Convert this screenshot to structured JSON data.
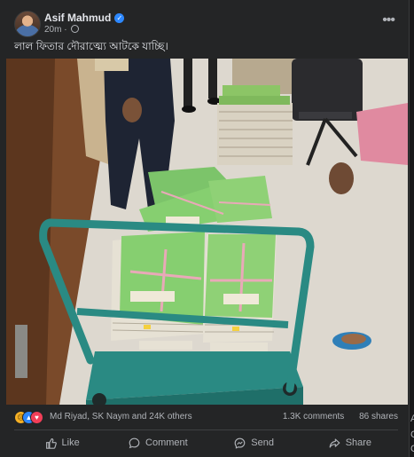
{
  "post": {
    "author": "Asif Mahmud",
    "time": "20m",
    "text": "লাল ফিতার দৌরাত্ম্যে আটকে যাচ্ছি।"
  },
  "reactions": {
    "names": "Md Riyad, SK Naym and 24K others",
    "comments": "1.3K comments",
    "shares": "86 shares"
  },
  "actions": {
    "like": "Like",
    "comment": "Comment",
    "send": "Send",
    "share": "Share"
  },
  "side_fragments": [
    "A",
    "C",
    "C"
  ],
  "colors": {
    "background": "#18191a",
    "card": "#242526",
    "verified": "#2d88ff",
    "secondary_text": "#b0b3b8"
  }
}
